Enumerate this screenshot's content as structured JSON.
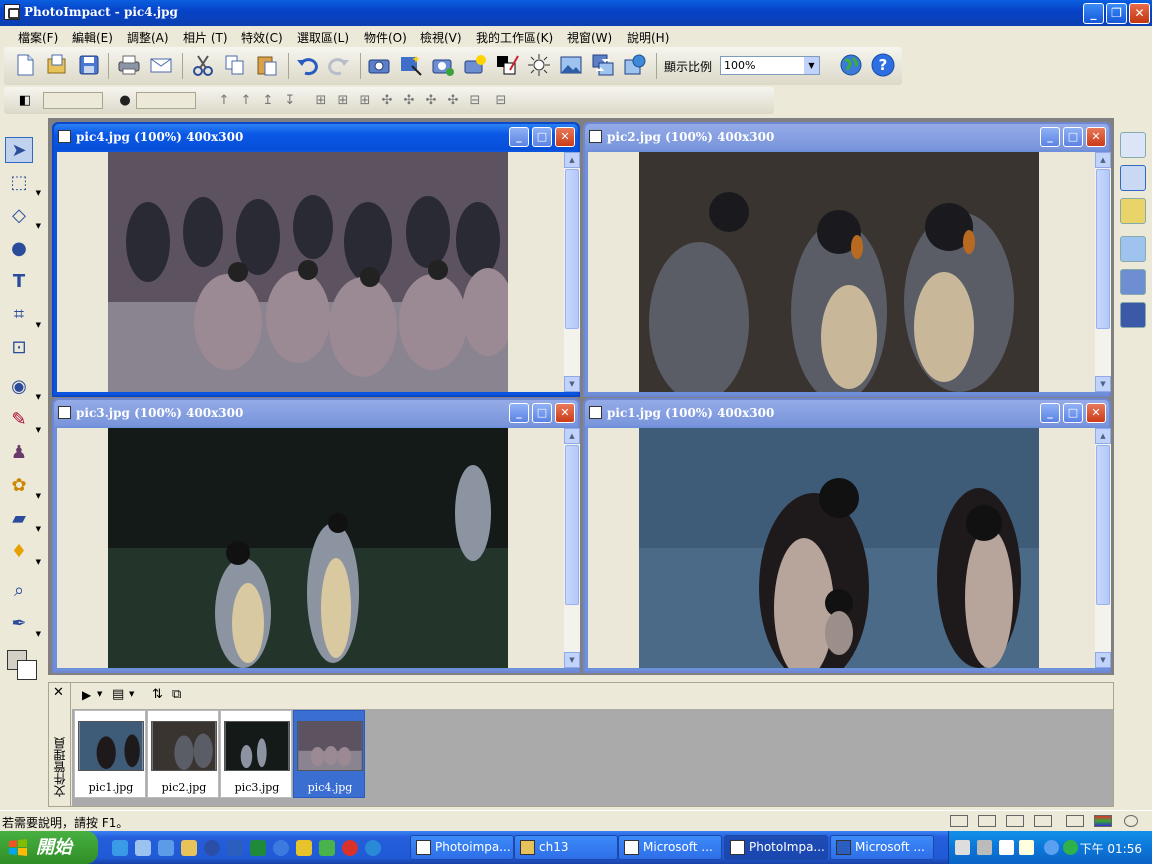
{
  "app": {
    "title": "PhotoImpact - pic4.jpg"
  },
  "menu": [
    "檔案(F)",
    "編輯(E)",
    "調整(A)",
    "相片 (T)",
    "特效(C)",
    "選取區(L)",
    "物件(O)",
    "檢視(V)",
    "我的工作區(K)",
    "視窗(W)",
    "說明(H)"
  ],
  "toolbar": {
    "zoom_label": "顯示比例",
    "zoom_value": "100%",
    "icons": [
      "new-icon",
      "open-icon",
      "save-icon",
      "print-icon",
      "mail-icon",
      "cut-icon",
      "copy-icon",
      "paste-icon",
      "undo-icon",
      "redo-icon",
      "camera-icon",
      "wand-icon",
      "scan-icon",
      "enhance-icon",
      "color-icon",
      "brightness-icon",
      "image-icon",
      "convert-icon",
      "ball-icon",
      "globe-icon",
      "help-icon"
    ]
  },
  "windows": [
    {
      "title": "pic4.jpg (100%) 400x300",
      "active": true
    },
    {
      "title": "pic2.jpg (100%) 400x300",
      "active": false
    },
    {
      "title": "pic3.jpg (100%) 400x300",
      "active": false
    },
    {
      "title": "pic1.jpg (100%) 400x300",
      "active": false
    }
  ],
  "doc_manager": {
    "label": "文件管理員",
    "thumbs": [
      {
        "name": "pic1.jpg",
        "selected": false
      },
      {
        "name": "pic2.jpg",
        "selected": false
      },
      {
        "name": "pic3.jpg",
        "selected": false
      },
      {
        "name": "pic4.jpg",
        "selected": true
      }
    ]
  },
  "status": {
    "message": "若需要說明，請按 F1。"
  },
  "taskbar": {
    "start": "開始",
    "tasks": [
      {
        "label": "Photoimpa...",
        "active": false
      },
      {
        "label": "ch13",
        "active": false
      },
      {
        "label": "Microsoft ...",
        "active": false
      },
      {
        "label": "PhotoImpa...",
        "active": true
      },
      {
        "label": "Microsoft ...",
        "active": false
      }
    ],
    "clock": "下午 01:56"
  },
  "colors": {
    "active_title": "#0a54e0",
    "inactive_title": "#7894da",
    "taskbar": "#245edb",
    "start": "#3c9b32"
  }
}
